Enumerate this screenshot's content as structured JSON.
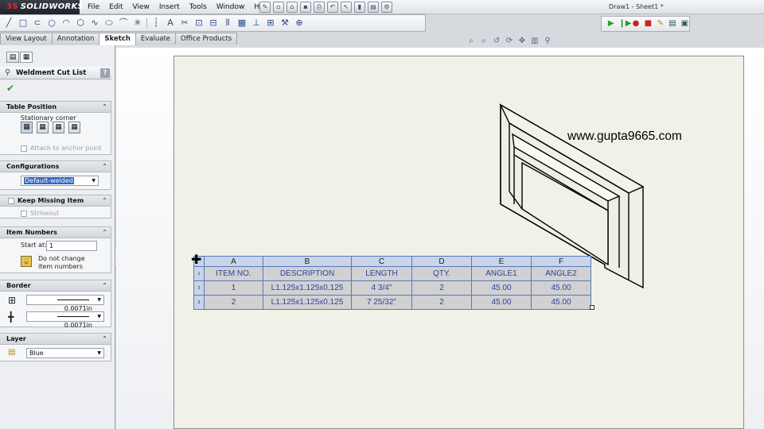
{
  "app": {
    "logo_ds": "3S",
    "logo_text": "SOLIDWORKS",
    "document_title": "Draw1 - Sheet1 *"
  },
  "menu": [
    "File",
    "Edit",
    "View",
    "Insert",
    "Tools",
    "Window",
    "Help"
  ],
  "tabs": [
    {
      "label": "View Layout",
      "active": false
    },
    {
      "label": "Annotation",
      "active": false
    },
    {
      "label": "Sketch",
      "active": true
    },
    {
      "label": "Evaluate",
      "active": false
    },
    {
      "label": "Office Products",
      "active": false
    }
  ],
  "property_manager": {
    "title": "Weldment Cut List",
    "help": "?",
    "table_position": {
      "title": "Table Position",
      "stationary_corner_label": "Stationary corner",
      "attach_label": "Attach to anchor point"
    },
    "configurations": {
      "title": "Configurations",
      "selected": "Default-welded"
    },
    "keep_missing": {
      "title": "Keep Missing Item",
      "strikeout_label": "Strikeout"
    },
    "item_numbers": {
      "title": "Item Numbers",
      "start_label": "Start at:",
      "start_value": "1",
      "do_not_change_line1": "Do not change",
      "do_not_change_line2": "item numbers"
    },
    "border": {
      "title": "Border",
      "value1": "0.0071in",
      "value2": "0.0071in"
    },
    "layer": {
      "title": "Layer",
      "selected": "Blue"
    }
  },
  "drawing": {
    "watermark": "www.gupta9665.com",
    "bom": {
      "column_letters": [
        "A",
        "B",
        "C",
        "D",
        "E",
        "F"
      ],
      "headers": [
        "ITEM NO.",
        "DESCRIPTION",
        "LENGTH",
        "QTY.",
        "ANGLE1",
        "ANGLE2"
      ],
      "rows": [
        [
          "1",
          "L1.125x1.125x0.125",
          "4 3/4\"",
          "2",
          "45.00",
          "45.00"
        ],
        [
          "2",
          "L1.125x1.125x0.125",
          "7 25/32\"",
          "2",
          "45.00",
          "45.00"
        ]
      ],
      "row_numbers": [
        "1",
        "2",
        "3"
      ]
    }
  }
}
